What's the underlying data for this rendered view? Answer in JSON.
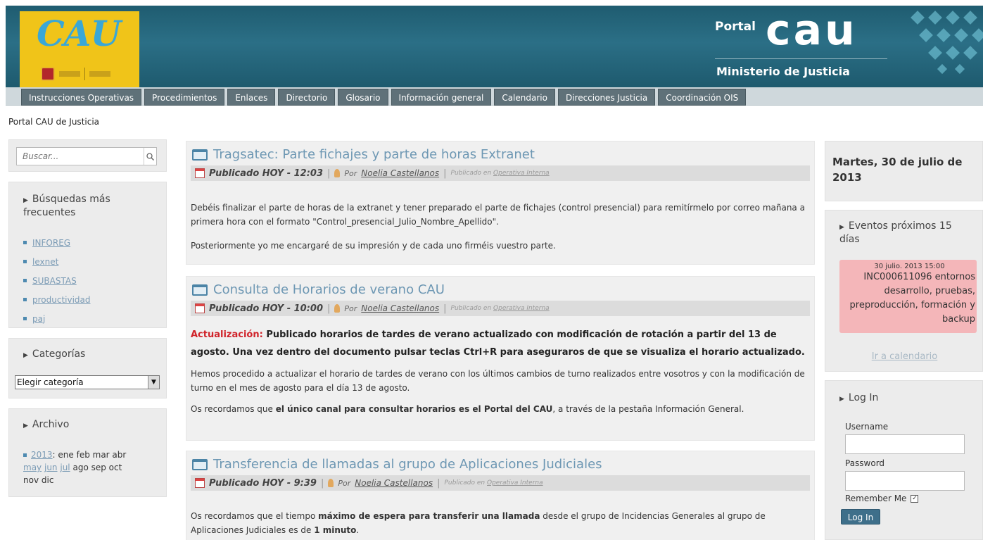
{
  "header": {
    "logo_text": "CAU",
    "portal_word": "Portal",
    "cau_word": "cau",
    "ministry": "Ministerio de Justicia"
  },
  "nav": {
    "tabs": [
      "Instrucciones Operativas",
      "Procedimientos",
      "Enlaces",
      "Directorio",
      "Glosario",
      "Información general",
      "Calendario",
      "Direcciones Justicia",
      "Coordinación OIS"
    ]
  },
  "breadcrumb": "Portal CAU de Justicia",
  "search": {
    "placeholder": "Buscar..."
  },
  "busquedas": {
    "title": "Búsquedas más frecuentes",
    "items": [
      "INFOREG",
      "lexnet",
      "SUBASTAS",
      "productividad",
      "paj"
    ]
  },
  "categorias": {
    "title": "Categorías",
    "selected": "Elegir categoría"
  },
  "archivo": {
    "title": "Archivo",
    "year": "2013",
    "sep": ": ",
    "months_plain_1": "ene feb mar abr",
    "month_may": "may",
    "month_jun": "jun",
    "month_jul": "jul",
    "months_plain_2": "ago sep oct",
    "months_plain_3": "nov dic"
  },
  "posts": [
    {
      "title": "Tragsatec: Parte fichajes y parte de horas Extranet",
      "published": "Publicado HOY - 12:03",
      "por": "Por",
      "author": "Noelia Castellanos",
      "pubin_prefix": "Publicado en",
      "pubin_cat": "Operativa Interna",
      "p1": "Debéis finalizar el parte de horas de la extranet y tener preparado el parte de fichajes (control presencial) para remitírmelo por correo mañana a primera hora con el formato \"Control_presencial_Julio_Nombre_Apellido\".",
      "p2": "Posteriormente yo me encargaré de su impresión y de cada uno firméis vuestro parte."
    },
    {
      "title": "Consulta de Horarios de verano CAU",
      "published": "Publicado HOY - 10:00",
      "por": "Por",
      "author": "Noelia Castellanos",
      "pubin_prefix": "Publicado en",
      "pubin_cat": "Operativa Interna",
      "update_label": "Actualización:",
      "update_text": " Publicado horarios de tardes de verano actualizado con modificación de rotación a partir del 13 de agosto. Una vez dentro del documento pulsar teclas Ctrl+R para aseguraros de que se visualiza el horario actualizado.",
      "p2": "Hemos procedido a actualizar el horario de tardes de verano con los últimos cambios de turno realizados entre vosotros y con la modificación de turno en el mes de agosto para el día 13 de agosto.",
      "p3_a": "Os recordamos que ",
      "p3_b": "el único canal para consultar horarios es el Portal del CAU",
      "p3_c": ", a través de la pestaña Información General."
    },
    {
      "title": "Transferencia de llamadas al grupo de Aplicaciones Judiciales",
      "published": "Publicado HOY - 9:39",
      "por": "Por",
      "author": "Noelia Castellanos",
      "pubin_prefix": "Publicado en",
      "pubin_cat": "Operativa Interna",
      "p1_a": "Os recordamos que el tiempo ",
      "p1_b": "máximo de espera para transferir una llamada",
      "p1_c": " desde el grupo de Incidencias Generales al grupo de Aplicaciones Judiciales es de ",
      "p1_d": "1 minuto",
      "p1_e": "."
    }
  ],
  "date_box": "Martes, 30 de julio de 2013",
  "events": {
    "title": "Eventos próximos 15 días",
    "date": "30 julio. 2013 15:00",
    "desc": "INC000611096 entornos desarrollo, pruebas, preproducción, formación y backup",
    "link": "Ir a calendario"
  },
  "login": {
    "title": "Log In",
    "username_label": "Username",
    "password_label": "Password",
    "remember_label": "Remember Me",
    "button": "Log In"
  },
  "colors": {
    "header": "#1f5c70",
    "nav_tab": "#5f7179",
    "link": "#6d97b3",
    "event_card": "#f4b6b9",
    "update_red": "#d0232a"
  }
}
